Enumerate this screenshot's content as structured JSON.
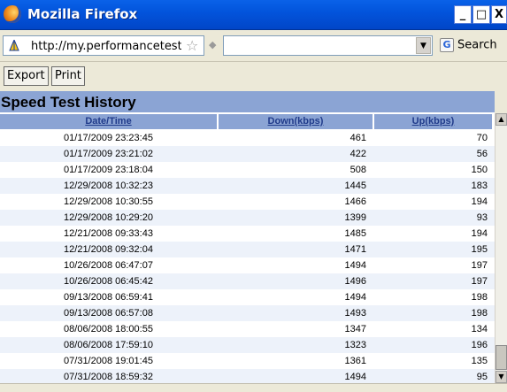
{
  "window": {
    "title": "Mozilla Firefox",
    "minimize": "_",
    "maximize": "□",
    "close": "X"
  },
  "nav": {
    "url": "http://my.performancetest",
    "search_label": "Search",
    "search_icon": "G"
  },
  "toolbar": {
    "export_label": "Export",
    "print_label": "Print"
  },
  "page": {
    "title": "Speed Test History",
    "columns": [
      "Date/Time",
      "Down(kbps)",
      "Up(kbps)"
    ],
    "rows": [
      [
        "01/17/2009 23:23:45",
        "461",
        "70"
      ],
      [
        "01/17/2009 23:21:02",
        "422",
        "56"
      ],
      [
        "01/17/2009 23:18:04",
        "508",
        "150"
      ],
      [
        "12/29/2008 10:32:23",
        "1445",
        "183"
      ],
      [
        "12/29/2008 10:30:55",
        "1466",
        "194"
      ],
      [
        "12/29/2008 10:29:20",
        "1399",
        "93"
      ],
      [
        "12/21/2008 09:33:43",
        "1485",
        "194"
      ],
      [
        "12/21/2008 09:32:04",
        "1471",
        "195"
      ],
      [
        "10/26/2008 06:47:07",
        "1494",
        "197"
      ],
      [
        "10/26/2008 06:45:42",
        "1496",
        "197"
      ],
      [
        "09/13/2008 06:59:41",
        "1494",
        "198"
      ],
      [
        "09/13/2008 06:57:08",
        "1493",
        "198"
      ],
      [
        "08/06/2008 18:00:55",
        "1347",
        "134"
      ],
      [
        "08/06/2008 17:59:10",
        "1323",
        "196"
      ],
      [
        "07/31/2008 19:01:45",
        "1361",
        "135"
      ],
      [
        "07/31/2008 18:59:32",
        "1494",
        "95"
      ]
    ]
  }
}
